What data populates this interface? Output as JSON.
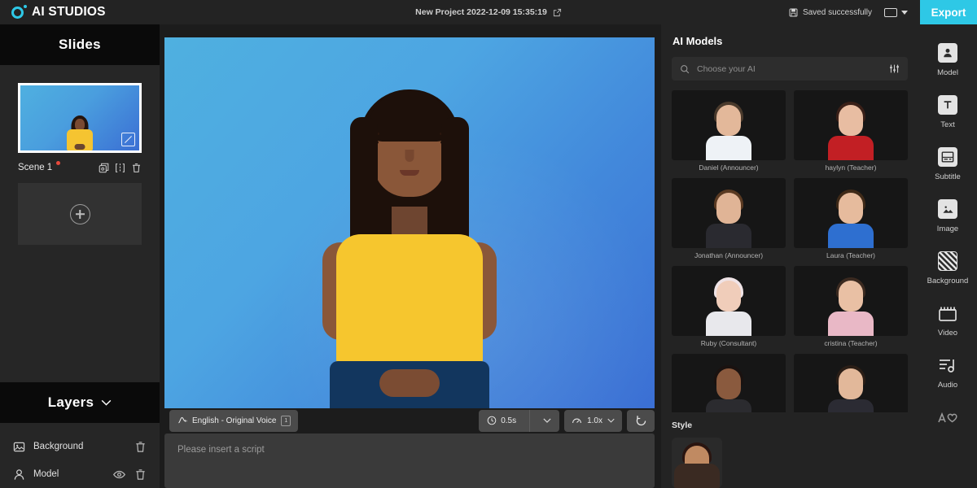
{
  "app": {
    "logo_text": "AI STUDIOS",
    "accent_color": "#2ec8e6",
    "bg_color": "#1c1c1c"
  },
  "topbar": {
    "project_title": "New Project 2022-12-09 15:35:19",
    "edit_icon": "edit-pencil-icon",
    "saved_status": "Saved successfully",
    "save_icon": "floppy-disk-icon",
    "ratio_icon": "aspect-ratio-icon",
    "export_label": "Export"
  },
  "slides": {
    "header": "Slides",
    "scene": {
      "name": "Scene 1",
      "has_unsaved_dot": true,
      "duplicate_icon": "duplicate-icon",
      "split_icon": "split-icon",
      "delete_icon": "trash-icon",
      "edit_icon": "edit-crop-icon"
    },
    "add_label": "+"
  },
  "layers": {
    "header": "Layers",
    "chevron_icon": "chevron-down-icon",
    "items": [
      {
        "label": "Background",
        "icon": "image-icon",
        "has_eye": false,
        "delete_icon": "trash-icon"
      },
      {
        "label": "Model",
        "icon": "person-icon",
        "has_eye": true,
        "delete_icon": "trash-icon"
      }
    ]
  },
  "stage": {
    "gradient_from": "#4fb0e0",
    "gradient_to": "#3b6fd4",
    "toolbar": {
      "voice_icon": "voice-wave-icon",
      "voice_label": "English - Original Voice",
      "voice_badge": "1",
      "clock_icon": "clock-icon",
      "delay_value": "0.5s",
      "delay_caret_icon": "chevron-down-icon",
      "speed_icon": "speed-gauge-icon",
      "speed_value": "1.0x",
      "speed_caret_icon": "chevron-down-icon",
      "reset_icon": "reset-icon"
    },
    "script_placeholder": "Please insert a script"
  },
  "models_panel": {
    "title": "AI Models",
    "search_placeholder": "Choose your AI",
    "search_value": "",
    "search_icon": "search-icon",
    "filter_icon": "filter-sliders-icon",
    "models": [
      {
        "label": "Daniel (Announcer)",
        "hair": "#4a3a2c",
        "skin": "#e3b89a",
        "outfit": "#eef2f6"
      },
      {
        "label": "haylyn (Teacher)",
        "hair": "#3a2018",
        "skin": "#e8bda2",
        "outfit": "#c21f24"
      },
      {
        "label": "Jonathan (Announcer)",
        "hair": "#5a3a22",
        "skin": "#e0b496",
        "outfit": "#2a2a30"
      },
      {
        "label": "Laura (Teacher)",
        "hair": "#3f2a18",
        "skin": "#e6bb9d",
        "outfit": "#2e6fd0"
      },
      {
        "label": "Ruby (Consultant)",
        "hair": "#efe3e6",
        "skin": "#f0cdba",
        "outfit": "#e8e8ec"
      },
      {
        "label": "cristina (Teacher)",
        "hair": "#3b2a20",
        "skin": "#e9c0a4",
        "outfit": "#e9b8c6"
      },
      {
        "label": "",
        "hair": "#1a1210",
        "skin": "#8a5a3e",
        "outfit": "#2b2b2f"
      },
      {
        "label": "",
        "hair": "#2b1e16",
        "skin": "#e2b89a",
        "outfit": "#2b2b33"
      }
    ],
    "style": {
      "title": "Style",
      "thumb_hair": "#2a1510",
      "thumb_skin": "#c08a62"
    }
  },
  "rail": {
    "items": [
      {
        "label": "Model",
        "icon": "model-person-icon"
      },
      {
        "label": "Text",
        "icon": "text-t-icon"
      },
      {
        "label": "Subtitle",
        "icon": "subtitle-icon"
      },
      {
        "label": "Image",
        "icon": "image-icon"
      },
      {
        "label": "Background",
        "icon": "background-hatch-icon"
      },
      {
        "label": "Video",
        "icon": "video-clapper-icon"
      },
      {
        "label": "Audio",
        "icon": "audio-note-icon"
      },
      {
        "label": "",
        "icon": "sticker-icon"
      }
    ]
  }
}
